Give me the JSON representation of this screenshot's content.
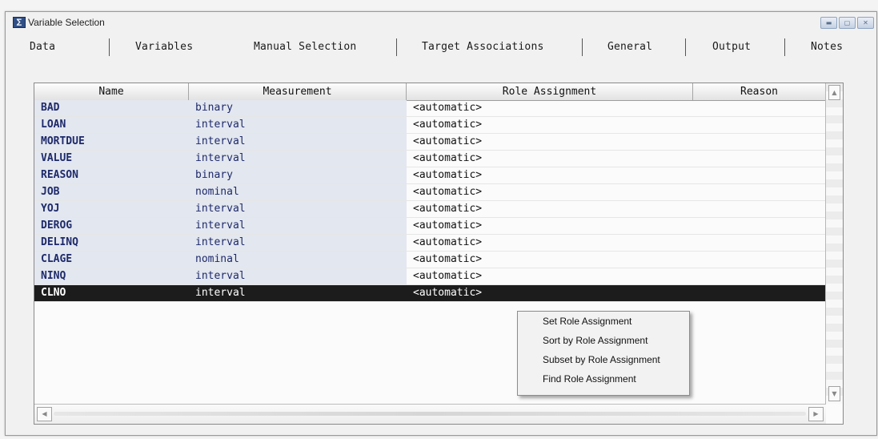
{
  "window": {
    "title": "Variable Selection",
    "icon": "sas-window-icon"
  },
  "tabs": [
    "Data",
    "Variables",
    "Manual Selection",
    "Target Associations",
    "General",
    "Output",
    "Notes"
  ],
  "table": {
    "columns": [
      "Name",
      "Measurement",
      "Role Assignment",
      "Reason"
    ],
    "rows": [
      {
        "name": "BAD",
        "measurement": "binary",
        "role": "<automatic>",
        "reason": ""
      },
      {
        "name": "LOAN",
        "measurement": "interval",
        "role": "<automatic>",
        "reason": ""
      },
      {
        "name": "MORTDUE",
        "measurement": "interval",
        "role": "<automatic>",
        "reason": ""
      },
      {
        "name": "VALUE",
        "measurement": "interval",
        "role": "<automatic>",
        "reason": ""
      },
      {
        "name": "REASON",
        "measurement": "binary",
        "role": "<automatic>",
        "reason": ""
      },
      {
        "name": "JOB",
        "measurement": "nominal",
        "role": "<automatic>",
        "reason": ""
      },
      {
        "name": "YOJ",
        "measurement": "interval",
        "role": "<automatic>",
        "reason": ""
      },
      {
        "name": "DEROG",
        "measurement": "interval",
        "role": "<automatic>",
        "reason": ""
      },
      {
        "name": "DELINQ",
        "measurement": "interval",
        "role": "<automatic>",
        "reason": ""
      },
      {
        "name": "CLAGE",
        "measurement": "nominal",
        "role": "<automatic>",
        "reason": ""
      },
      {
        "name": "NINQ",
        "measurement": "interval",
        "role": "<automatic>",
        "reason": ""
      },
      {
        "name": "CLNO",
        "measurement": "interval",
        "role": "<automatic>",
        "reason": "",
        "selected": true
      }
    ]
  },
  "context_menu": {
    "items": [
      "Set Role Assignment",
      "Sort by Role Assignment",
      "Subset by Role Assignment",
      "Find Role Assignment"
    ]
  },
  "colors": {
    "selected_row": "#1c1c1c",
    "name_column_bg": "#e3e7ef",
    "name_text": "#1e2a6b"
  }
}
